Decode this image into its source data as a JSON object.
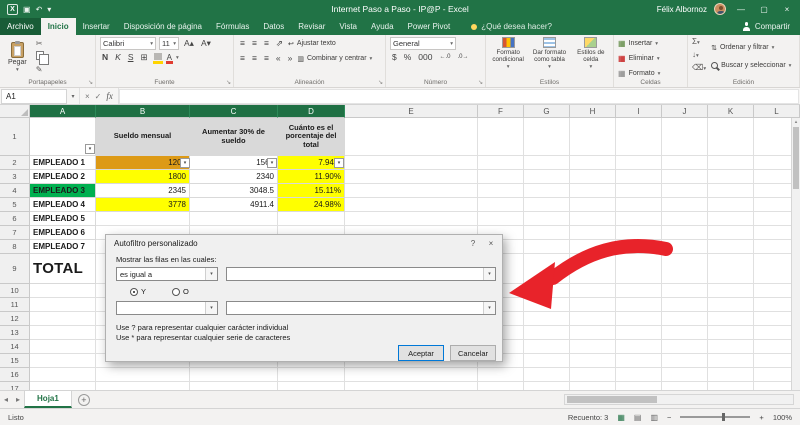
{
  "icons": {
    "excel": "X",
    "save": "▣",
    "undo": "↶",
    "dropdown": "▾",
    "minimize": "—",
    "maximize": "▢",
    "close": "×",
    "scissors": "✂",
    "brush": "✎",
    "launcher": "↘",
    "grow_font": "A▴",
    "shrink_font": "A▾",
    "borders": "⊞",
    "align": "≡",
    "orient": "⇗",
    "wrap_arrow": "↩",
    "merge_box": "▥",
    "outdent": "«",
    "indent": "»",
    "sum": "Σ",
    "fill_down": "↓",
    "eraser": "⌫",
    "sort": "⇅",
    "check": "✓",
    "cross": "×",
    "up_small": "▴",
    "nav_left": "◂",
    "nav_right": "▸",
    "plus": "+",
    "help": "?",
    "view_normal": "▦",
    "view_layout": "▤",
    "view_break": "▥",
    "zoom_minus": "−",
    "zoom_plus": "+",
    "inc_decimal": "←.0",
    "dec_decimal": ".0→"
  },
  "colors": {
    "accent_green": "#217346",
    "cell_orange": "#dd9a16",
    "cell_yellow": "#ffff00",
    "cell_green": "#00b050",
    "header_gray": "#d9d9d9",
    "arrow_red": "#e8232a"
  },
  "title_bar": {
    "title": "Internet Paso a Paso - IP@P - Excel",
    "user": "Félix Albornoz"
  },
  "ribbon": {
    "tabs": [
      "Archivo",
      "Inicio",
      "Insertar",
      "Disposición de página",
      "Fórmulas",
      "Datos",
      "Revisar",
      "Vista",
      "Ayuda",
      "Power Pivot"
    ],
    "search": "¿Qué desea hacer?",
    "share": "Compartir",
    "groups": {
      "portapapeles": {
        "label": "Portapapeles",
        "paste": "Pegar"
      },
      "fuente": {
        "label": "Fuente",
        "font": "Calibri",
        "size": "11",
        "bold": "N",
        "italic": "K",
        "underline": "S"
      },
      "alineacion": {
        "label": "Alineación",
        "wrap": "Ajustar texto",
        "merge": "Combinar y centrar"
      },
      "numero": {
        "label": "Número",
        "format": "General",
        "currency": "$",
        "percent": "%",
        "thousands": "000"
      },
      "estilos": {
        "label": "Estilos",
        "conditional": "Formato condicional",
        "as_table": "Dar formato como tabla",
        "cell_styles": "Estilos de celda"
      },
      "celdas": {
        "label": "Celdas",
        "insert": "Insertar",
        "delete": "Eliminar",
        "format": "Formato"
      },
      "edicion": {
        "label": "Edición",
        "sort": "Ordenar y filtrar",
        "find": "Buscar y seleccionar"
      }
    }
  },
  "formula": {
    "name_box": "A1",
    "fx": "fx"
  },
  "grid": {
    "cols": [
      "A",
      "B",
      "C",
      "D",
      "E",
      "F",
      "G",
      "H",
      "I",
      "J",
      "K",
      "L"
    ],
    "rows": [
      "1",
      "2",
      "3",
      "4",
      "5",
      "6",
      "7",
      "8",
      "9",
      "10",
      "11",
      "12",
      "13",
      "14",
      "15",
      "16",
      "17"
    ],
    "table": {
      "headers": [
        "",
        "Sueldo mensual",
        "Aumentar 30% de sueldo",
        "Cuánto es el porcentaje del total"
      ],
      "rows": [
        {
          "name": "EMPLEADO 1",
          "sueldo": "1200",
          "aumento": "1560",
          "pct": "7.94%"
        },
        {
          "name": "EMPLEADO 2",
          "sueldo": "1800",
          "aumento": "2340",
          "pct": "11.90%"
        },
        {
          "name": "EMPLEADO 3",
          "sueldo": "2345",
          "aumento": "3048.5",
          "pct": "15.11%"
        },
        {
          "name": "EMPLEADO 4",
          "sueldo": "3778",
          "aumento": "4911.4",
          "pct": "24.98%"
        },
        {
          "name": "EMPLEADO 5"
        },
        {
          "name": "EMPLEADO 6"
        },
        {
          "name": "EMPLEADO 7"
        }
      ],
      "total_label": "TOTAL"
    }
  },
  "dialog": {
    "title": "Autofiltro personalizado",
    "show_rows_label": "Mostrar las filas en las cuales:",
    "operator": "es igual a",
    "and_label": "Y",
    "or_label": "O",
    "hint1": "Use ? para representar cualquier carácter individual",
    "hint2": "Use * para representar cualquier serie de caracteres",
    "ok": "Aceptar",
    "cancel": "Cancelar"
  },
  "sheet": {
    "name": "Hoja1"
  },
  "status": {
    "ready": "Listo",
    "count": "Recuento: 3",
    "zoom": "100%"
  }
}
